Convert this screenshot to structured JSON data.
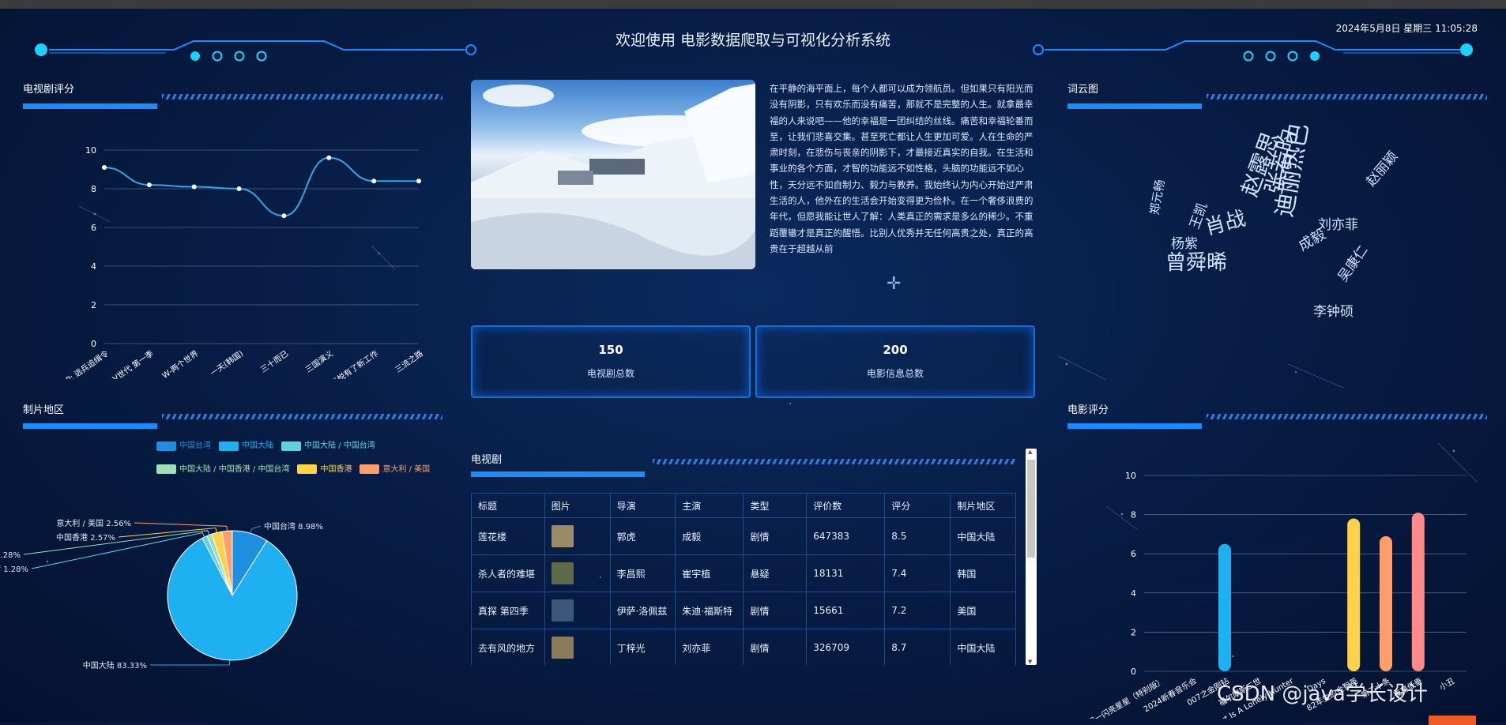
{
  "header": {
    "title": "欢迎使用 电影数据爬取与可视化分析系统",
    "datetime": "2024年5月8日 星期三 11:05:28"
  },
  "tv_rating_panel": {
    "title": "电视剧评分",
    "chart_data": {
      "type": "line",
      "categories": [
        "D.P: 逃兵追缉令",
        "V世代 第一季",
        "W-两个世界",
        "一天(韩国)",
        "三十而已",
        "三国演义",
        "三悦有了新工作",
        "三流之路"
      ],
      "values": [
        9.1,
        8.2,
        8.1,
        8.0,
        6.6,
        9.6,
        8.4,
        8.4
      ],
      "ylim": [
        0,
        10
      ],
      "yticks": [
        0,
        2,
        4,
        6,
        8,
        10
      ],
      "color": "#2fa8e8"
    }
  },
  "region_panel": {
    "title": "制片地区",
    "chart_data": {
      "type": "pie",
      "slices": [
        {
          "name": "中国台湾",
          "value": 8.98,
          "color": "#1f8fe0",
          "label": "中国台湾 8.98%"
        },
        {
          "name": "中国大陆",
          "value": 83.33,
          "color": "#1eb0f0",
          "label": "中国大陆 83.33%"
        },
        {
          "name": "中国大陆 / 中国台湾",
          "value": 1.28,
          "color": "#5fd2e0",
          "label": "中国大陆 / 中国台湾 1.28%"
        },
        {
          "name": "中国大陆 / 中国香港 / 中国台湾",
          "value": 1.28,
          "color": "#9be0b5",
          "label": "中国大陆 / 中国香港 / 中国台湾 1.28%"
        },
        {
          "name": "中国香港",
          "value": 2.57,
          "color": "#ffd24a",
          "label": "中国香港 2.57%"
        },
        {
          "name": "意大利 / 美国",
          "value": 2.56,
          "color": "#ff9e6b",
          "label": "意大利 / 美国 2.56%"
        }
      ]
    }
  },
  "article": {
    "text": "在平静的海平面上，每个人都可以成为领航员。但如果只有阳光而没有阴影，只有欢乐而没有痛苦，那就不是完整的人生。就拿最幸福的人来说吧——他的幸福是一团纠结的丝线。痛苦和幸福轮番而至，让我们悲喜交集。甚至死亡都让人生更加可爱。人在生命的严肃时刻，在悲伤与丧亲的阴影下，才最接近真实的自我。在生活和事业的各个方面，才智的功能远不如性格，头脑的功能远不如心性，天分远不如自制力、毅力与教养。我始终认为内心开始过严肃生活的人，他外在的生活会开始变得更为俭朴。在一个奢侈浪费的年代，但愿我能让世人了解：人类真正的需求是多么的稀少。不重蹈覆辙才是真正的醒悟。比别人优秀并无任何高贵之处，真正的高贵在于超越从前"
  },
  "stats": [
    {
      "value": "150",
      "label": "电视剧总数"
    },
    {
      "value": "200",
      "label": "电影信息总数"
    }
  ],
  "tv_table": {
    "title": "电视剧",
    "headers": [
      "标题",
      "图片",
      "导演",
      "主演",
      "类型",
      "评价数",
      "评分",
      "制片地区"
    ],
    "rows": [
      {
        "title": "莲花楼",
        "director": "郭虎",
        "actor": "成毅",
        "genre": "剧情",
        "votes": "647383",
        "score": "8.5",
        "region": "中国大陆",
        "thumb": "#9a8a6a"
      },
      {
        "title": "杀人者的难堪",
        "director": "李昌熙",
        "actor": "崔宇植",
        "genre": "悬疑",
        "votes": "18131",
        "score": "7.4",
        "region": "韩国",
        "thumb": "#5d6b4a"
      },
      {
        "title": "真探 第四季",
        "director": "伊萨·洛佩兹",
        "actor": "朱迪·福斯特",
        "genre": "剧情",
        "votes": "15661",
        "score": "7.2",
        "region": "美国",
        "thumb": "#3b5878"
      },
      {
        "title": "去有风的地方",
        "director": "丁梓光",
        "actor": "刘亦菲",
        "genre": "剧情",
        "votes": "326709",
        "score": "8.7",
        "region": "中国大陆",
        "thumb": "#8b7a5a"
      }
    ]
  },
  "wordcloud_panel": {
    "title": "词云图",
    "words": [
      {
        "text": "迪丽热巴",
        "color": "#5fd36a"
      },
      {
        "text": "张若昀",
        "color": "#4fb7ff"
      },
      {
        "text": "赵露思",
        "color": "#7fd36a"
      },
      {
        "text": "曾舜晞",
        "color": "#f2c36a"
      },
      {
        "text": "肖战",
        "color": "#e0c0ff"
      },
      {
        "text": "李钟硕",
        "color": "#dfe7f0"
      },
      {
        "text": "刘亦菲",
        "color": "#9aa8c0"
      },
      {
        "text": "杨紫",
        "color": "#a0a8b8"
      },
      {
        "text": "成毅",
        "color": "#7aa8ff"
      },
      {
        "text": "吴康仁",
        "color": "#6f9fff"
      },
      {
        "text": "赵丽颖",
        "color": "#ff7fb8"
      },
      {
        "text": "王凯",
        "color": "#ffb86f"
      },
      {
        "text": "郑元畅",
        "color": "#8f9fb0"
      }
    ]
  },
  "movie_rating_panel": {
    "title": "电影评分",
    "chart_data": {
      "type": "bar",
      "categories": [
        "一闪一闪亮星星（特别版）",
        "2024新春音乐会",
        "007之金刚钻",
        "福尔摩斯二世",
        "The Heart Is A Lonely Hunter",
        "Days",
        "82年生的金智英",
        "第二十条",
        "夜幕低垂",
        "小丑"
      ],
      "values": [
        0,
        0,
        6.5,
        0,
        0,
        0,
        7.8,
        6.9,
        8.1,
        0
      ],
      "ylim": [
        0,
        10
      ],
      "yticks": [
        0,
        2,
        4,
        6,
        8,
        10
      ],
      "colors": [
        "#1eb0f0",
        "#1eb0f0",
        "#1eb0f0",
        "#1eb0f0",
        "#1eb0f0",
        "#1eb0f0",
        "#ffd24a",
        "#ff9e6b",
        "#ff8a8a",
        "#ff8a8a"
      ]
    }
  },
  "watermark": "CSDN @java学长设计"
}
